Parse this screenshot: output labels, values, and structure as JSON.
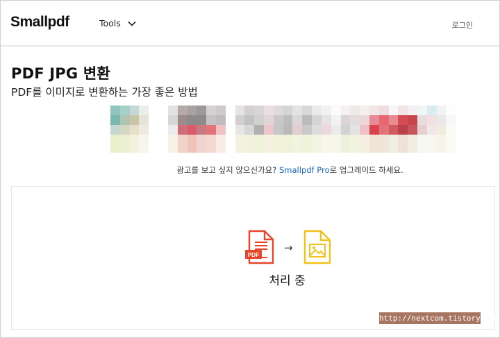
{
  "header": {
    "logo": "Smallpdf",
    "tools_label": "Tools",
    "login_label": "로그인"
  },
  "page": {
    "title": "PDF JPG 변환",
    "subtitle": "PDF를 이미지로 변환하는 가장 좋은 방법"
  },
  "ad": {
    "caption_before": "광고를 보고 싶지 않으신가요? ",
    "caption_link": "Smallpdf Pro",
    "caption_after": "로 업그레이드 하세요."
  },
  "converter": {
    "pdf_badge": "PDF",
    "status": "처리 중"
  },
  "watermark": "http://nextcom.tistory.com",
  "colors": {
    "pdf_icon": "#e8462a",
    "image_icon": "#f2c21b",
    "link": "#1a65c0"
  }
}
